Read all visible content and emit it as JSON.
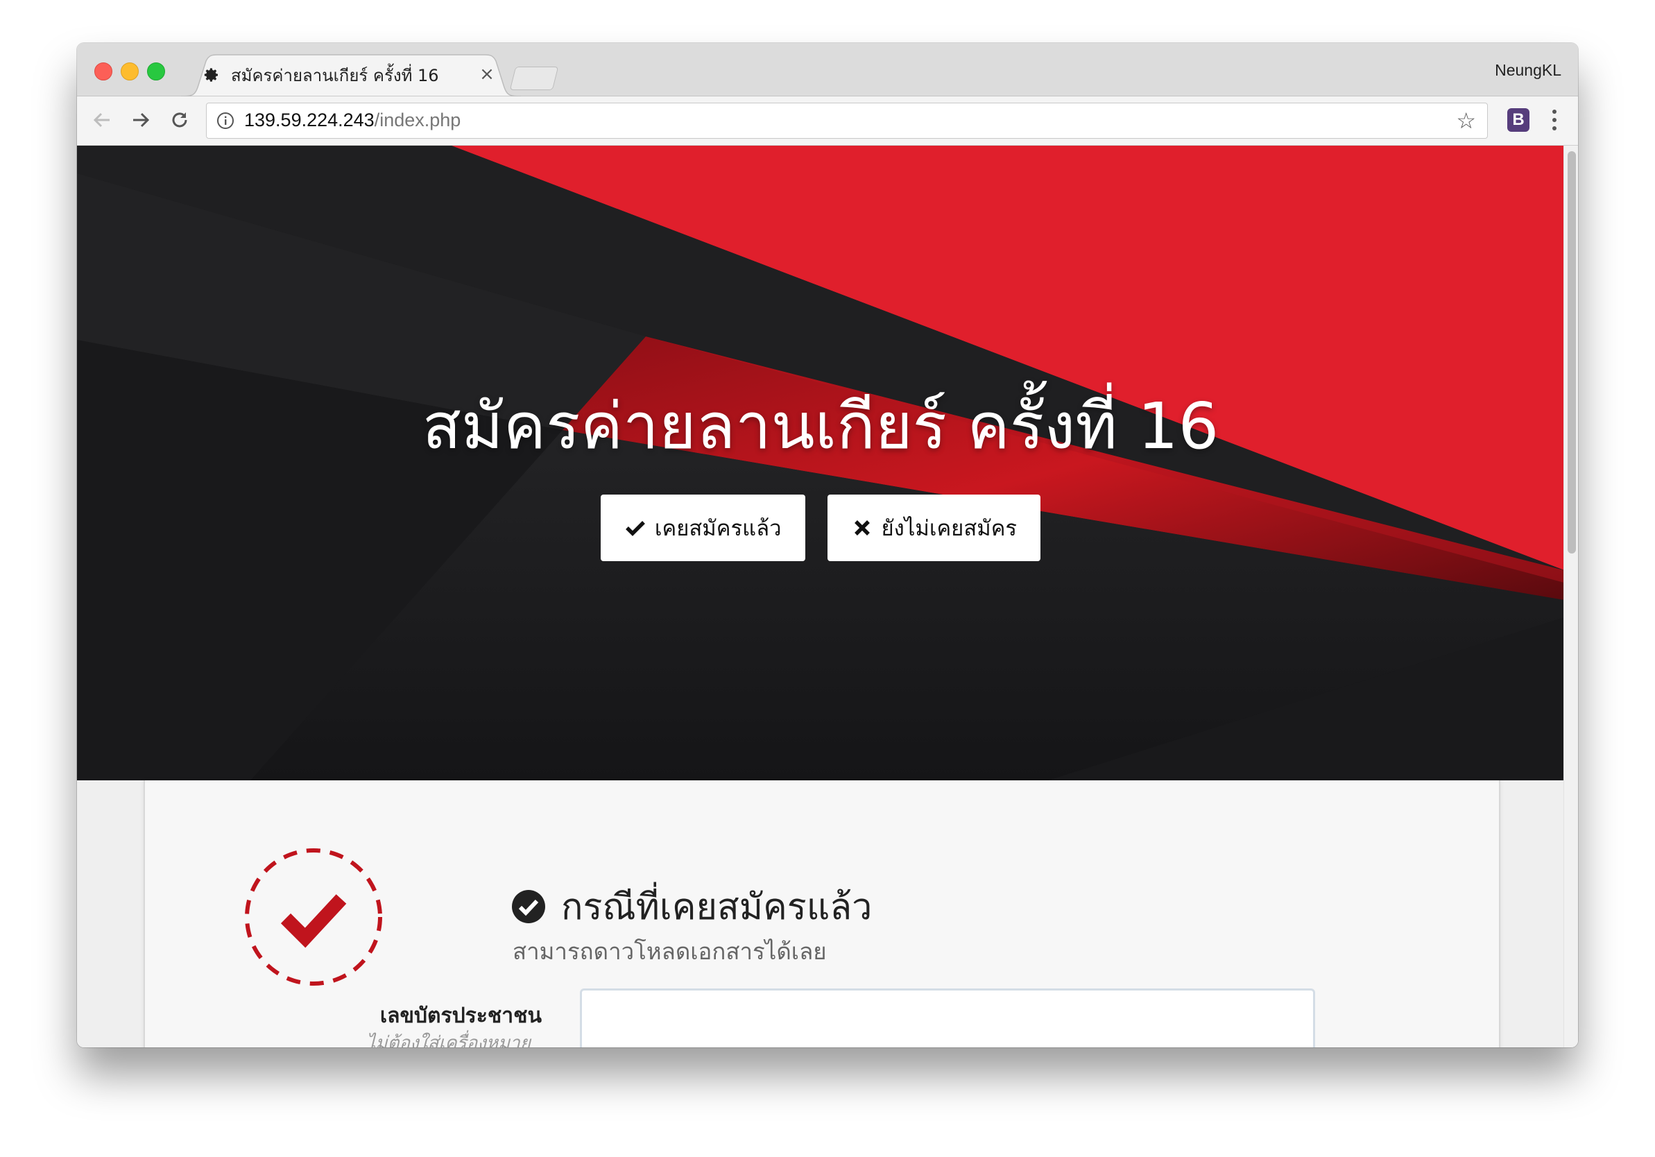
{
  "browser": {
    "tab_title": "สมัครค่ายลานเกียร์ ครั้งที่ 16",
    "tab_close": "×",
    "profile_name": "NeungKL",
    "url_host": "139.59.224.243",
    "url_path": "/index.php",
    "star_glyph": "☆",
    "extension_label": "B"
  },
  "hero": {
    "title": "สมัครค่ายลานเกียร์ ครั้งที่ 16",
    "registered_button": "เคยสมัครแล้ว",
    "not_registered_button": "ยังไม่เคยสมัคร",
    "accent_color": "#e01f2c",
    "dark_color": "#1c1c1e"
  },
  "section": {
    "title": "กรณีที่เคยสมัครแล้ว",
    "subtitle": "สามารถดาวโหลดเอกสารได้เลย",
    "id_label": "เลขบัตรประชาชน",
    "id_hint": "ไม่ต้องใส่เครื่องหมาย",
    "id_value": ""
  },
  "icons": {
    "tab_icon": "gear-icon",
    "back": "arrow-left-icon",
    "forward": "arrow-right-icon",
    "reload": "reload-icon",
    "info": "info-icon",
    "bookmark": "star-icon",
    "menu": "kebab-menu-icon",
    "badge": "dashed-circle-check-icon"
  }
}
